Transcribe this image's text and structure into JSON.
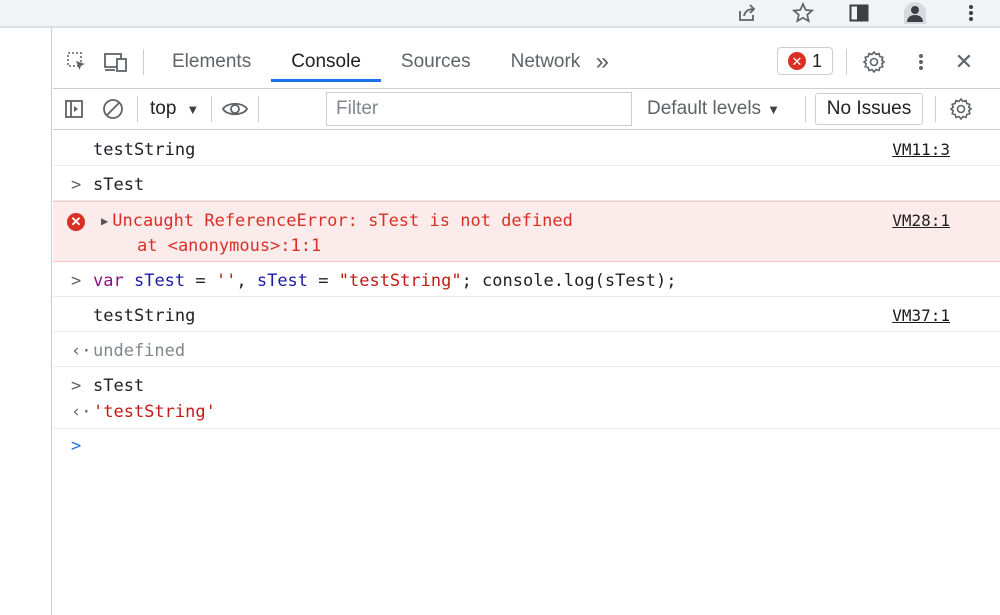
{
  "browser": {
    "icons": [
      "share-icon",
      "star-icon",
      "side-panel-icon",
      "profile-icon",
      "menu-icon"
    ]
  },
  "devtools": {
    "tabs": [
      {
        "label": "Elements",
        "active": false
      },
      {
        "label": "Console",
        "active": true
      },
      {
        "label": "Sources",
        "active": false
      },
      {
        "label": "Network",
        "active": false
      }
    ],
    "more_tabs": "»",
    "error_count": "1",
    "close_glyph": "✕",
    "toolbar": {
      "context": "top",
      "filter_placeholder": "Filter",
      "levels": "Default levels",
      "issues": "No Issues"
    }
  },
  "console": {
    "messages": [
      {
        "type": "log",
        "text": "testString",
        "source": "VM11:3"
      },
      {
        "type": "input",
        "text": "sTest"
      },
      {
        "type": "error",
        "text": "Uncaught ReferenceError: sTest is not defined",
        "stack": "at <anonymous>:1:1",
        "source": "VM28:1"
      },
      {
        "type": "input",
        "tokens": {
          "kw": "var",
          "v1": "sTest",
          "eq1": " = ",
          "s1": "''",
          "comma": ", ",
          "v2": "sTest",
          "eq2": " = ",
          "s2": "\"testString\"",
          "rest": "; console.log(sTest);"
        }
      },
      {
        "type": "log",
        "text": "testString",
        "source": "VM37:1"
      },
      {
        "type": "result",
        "text": "undefined"
      },
      {
        "type": "input",
        "text": "sTest"
      },
      {
        "type": "result",
        "text": "'testString'"
      }
    ]
  },
  "colors": {
    "accent": "#1a73e8",
    "error": "#d93025",
    "error_bg": "#fcebeb"
  }
}
